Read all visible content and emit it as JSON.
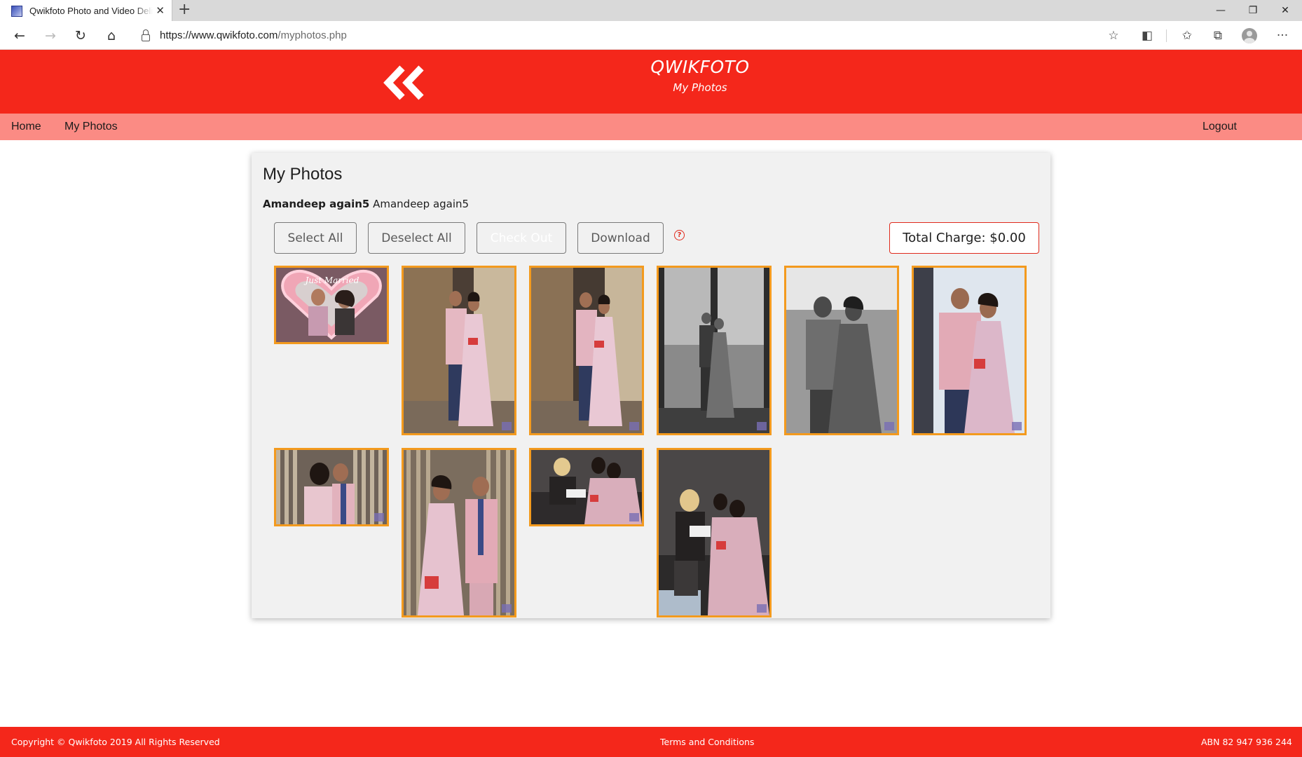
{
  "browser": {
    "tab_title": "Qwikfoto Photo and Video Delivery",
    "url_host": "https://www.qwikfoto.com",
    "url_path": "/myphotos.php"
  },
  "header": {
    "title": "QWIKFOTO",
    "subtitle": "My Photos"
  },
  "nav": {
    "home": "Home",
    "my_photos": "My Photos",
    "logout": "Logout"
  },
  "main": {
    "page_title": "My Photos",
    "owner_bold": "Amandeep again5",
    "owner_name": "Amandeep again5",
    "select_all": "Select All",
    "deselect_all": "Deselect All",
    "check_out": "Check Out",
    "download": "Download",
    "help": "?",
    "total_charge": "Total Charge: $0.00"
  },
  "photos": [
    {
      "name": "photo-1",
      "style": "heart-frame"
    },
    {
      "name": "photo-2",
      "style": "couple-color"
    },
    {
      "name": "photo-3",
      "style": "couple-color"
    },
    {
      "name": "photo-4",
      "style": "couple-bw-window"
    },
    {
      "name": "photo-5",
      "style": "couple-bw-city"
    },
    {
      "name": "photo-6",
      "style": "couple-window-color"
    },
    {
      "name": "photo-7",
      "style": "couple-side"
    },
    {
      "name": "photo-8",
      "style": "couple-standing"
    },
    {
      "name": "photo-9",
      "style": "signing"
    },
    {
      "name": "photo-10",
      "style": "signing-tall"
    }
  ],
  "footer": {
    "copyright": "Copyright © Qwikfoto 2019 All Rights Reserved",
    "terms": "Terms and Conditions",
    "abn": "ABN 82 947 936 244"
  },
  "colors": {
    "brand_red": "#f4271b",
    "nav_pink": "#fb8b84",
    "photo_border": "#f39a1e"
  }
}
